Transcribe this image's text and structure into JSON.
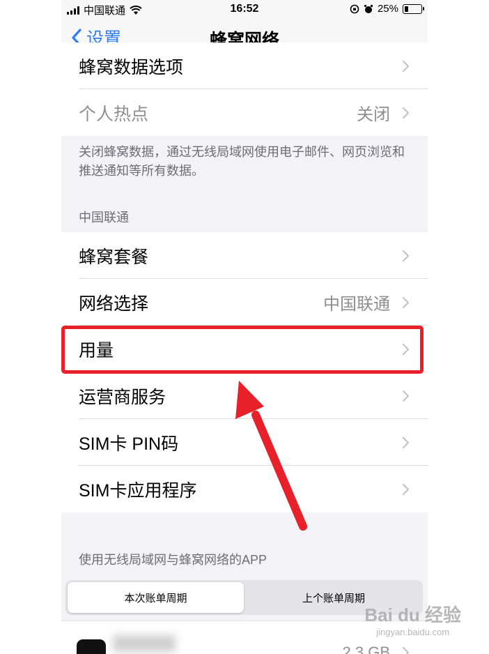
{
  "status_bar": {
    "carrier": "中国联通",
    "time": "16:52",
    "battery": "25%",
    "battery_level": 0.25
  },
  "nav": {
    "back_label": "设置",
    "title": "蜂窝网络"
  },
  "group_top": {
    "items": [
      {
        "label": "蜂窝数据选项",
        "value": ""
      },
      {
        "label": "个人热点",
        "value": "关闭"
      }
    ]
  },
  "footer_note": "关闭蜂窝数据，通过无线局域网使用电子邮件、网页浏览和推送通知等所有数据。",
  "carrier_section": {
    "header": "中国联通",
    "items": [
      {
        "label": "蜂窝套餐",
        "value": ""
      },
      {
        "label": "网络选择",
        "value": "中国联通"
      },
      {
        "label": "用量",
        "value": ""
      },
      {
        "label": "运营商服务",
        "value": ""
      },
      {
        "label": "SIM卡 PIN码",
        "value": ""
      },
      {
        "label": "SIM卡应用程序",
        "value": ""
      }
    ]
  },
  "app_section": {
    "header": "使用无线局域网与蜂窝网络的APP",
    "segments": [
      "本次账单周期",
      "上个账单周期"
    ],
    "first_app_size": "2.3 GB"
  },
  "watermark": {
    "top": "Bai du 经验",
    "bottom": "jingyan.baidu.com"
  },
  "colors": {
    "accent": "#2f7cf6",
    "highlight": "#e8202a",
    "background": "#f2f2f7"
  }
}
